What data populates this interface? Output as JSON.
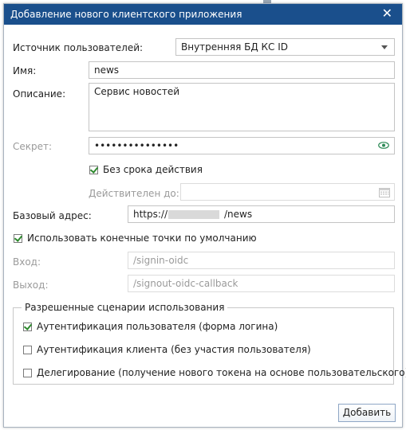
{
  "dialog": {
    "title": "Добавление нового клиентского приложения",
    "close_glyph": "✕",
    "source_label": "Источник пользователей:",
    "source_value": "Внутренняя БД КС ID",
    "name_label": "Имя:",
    "name_value": "news",
    "description_label": "Описание:",
    "description_value": "Сервис новостей",
    "secret_label": "Секрет:",
    "secret_value": "•••••••••••••••",
    "no_expiry_label": "Без срока действия",
    "no_expiry_checked": true,
    "valid_until_label": "Действителен до:",
    "valid_until_value": "",
    "base_address_label": "Базовый адрес:",
    "base_address_prefix": "https://",
    "base_address_suffix": "/news",
    "default_endpoints_label": "Использовать конечные точки по умолчанию",
    "default_endpoints_checked": true,
    "login_label": "Вход:",
    "login_value": "/signin-oidc",
    "logout_label": "Выход:",
    "logout_value": "/signout-oidc-callback",
    "scenarios_legend": "Разрешенные сценарии использования",
    "scenarios": [
      {
        "label": "Аутентификация пользователя (форма логина)",
        "checked": true
      },
      {
        "label": "Аутентификация клиента (без участия пользователя)",
        "checked": false
      },
      {
        "label": "Делегирование (получение нового токена на основе пользовательского)",
        "checked": false
      }
    ],
    "add_button": "Добавить"
  },
  "colors": {
    "titlebar": "#1a4f8c",
    "checkmark": "#2d8a2d",
    "eye_icon": "#2e8b57"
  },
  "icons": {
    "close": "close-icon",
    "dropdown": "chevron-down-icon",
    "show_secret": "eye-icon",
    "date_picker": "calendar-icon",
    "check": "checkmark-icon"
  }
}
